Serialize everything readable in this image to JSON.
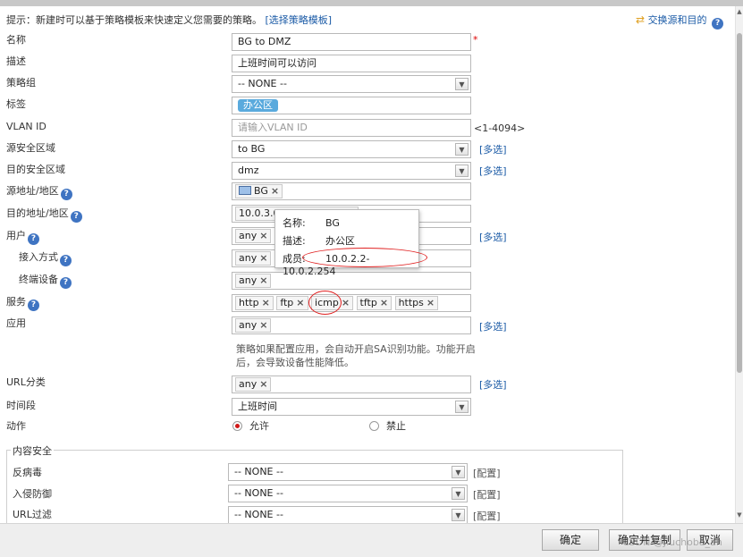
{
  "hint": {
    "text": "提示：新建时可以基于策略模板来快速定义您需要的策略。",
    "link": "[选择策略模板]"
  },
  "swap_label": "交换源和目的",
  "labels": {
    "name": "名称",
    "desc": "描述",
    "group": "策略组",
    "tag": "标签",
    "vlan": "VLAN ID",
    "src_zone": "源安全区域",
    "dst_zone": "目的安全区域",
    "src_addr": "源地址/地区",
    "dst_addr": "目的地址/地区",
    "user": "用户",
    "access": "接入方式",
    "terminal": "终端设备",
    "service": "服务",
    "app": "应用",
    "url": "URL分类",
    "time": "时间段",
    "action": "动作"
  },
  "fields": {
    "name": "BG to DMZ",
    "desc": "上班时间可以访问",
    "group": "-- NONE --",
    "tag": "办公区",
    "vlan_placeholder": "请输入VLAN ID",
    "vlan_range": "<1-4094>",
    "src_zone": "to BG",
    "dst_zone": "dmz",
    "src_addr": "BG",
    "dst_addr": "10.0.3.0/255.255.255.0",
    "user": "any",
    "access": "any",
    "terminal": "any",
    "services": [
      "http",
      "ftp",
      "icmp",
      "tftp",
      "https"
    ],
    "app": "any",
    "app_note": "策略如果配置应用，会自动开启SA识别功能。功能开启后，会导致设备性能降低。",
    "url": "any",
    "time": "上班时间",
    "required_mark": "*",
    "multi_select": "[多选]"
  },
  "action": {
    "allow": "允许",
    "deny": "禁止",
    "selected": "allow"
  },
  "tooltip": {
    "name_k": "名称:",
    "name_v": "BG",
    "desc_k": "描述:",
    "desc_v": "办公区",
    "member_k": "成员:",
    "member_v": "10.0.2.2-10.0.2.254"
  },
  "content_security": {
    "legend": "内容安全",
    "antivirus": "反病毒",
    "ips": "入侵防御",
    "url_filter": "URL过滤",
    "value": "-- NONE --",
    "config": "[配置]"
  },
  "buttons": {
    "ok": "确定",
    "ok_copy": "确定并复制",
    "cancel": "取消"
  },
  "watermark": "CSDN @Jiuchoba_an",
  "colors": {
    "link": "#1a5aa6",
    "tag_bg": "#5aaadd",
    "annotation": "#e02020",
    "help_icon": "#3f74c2"
  }
}
